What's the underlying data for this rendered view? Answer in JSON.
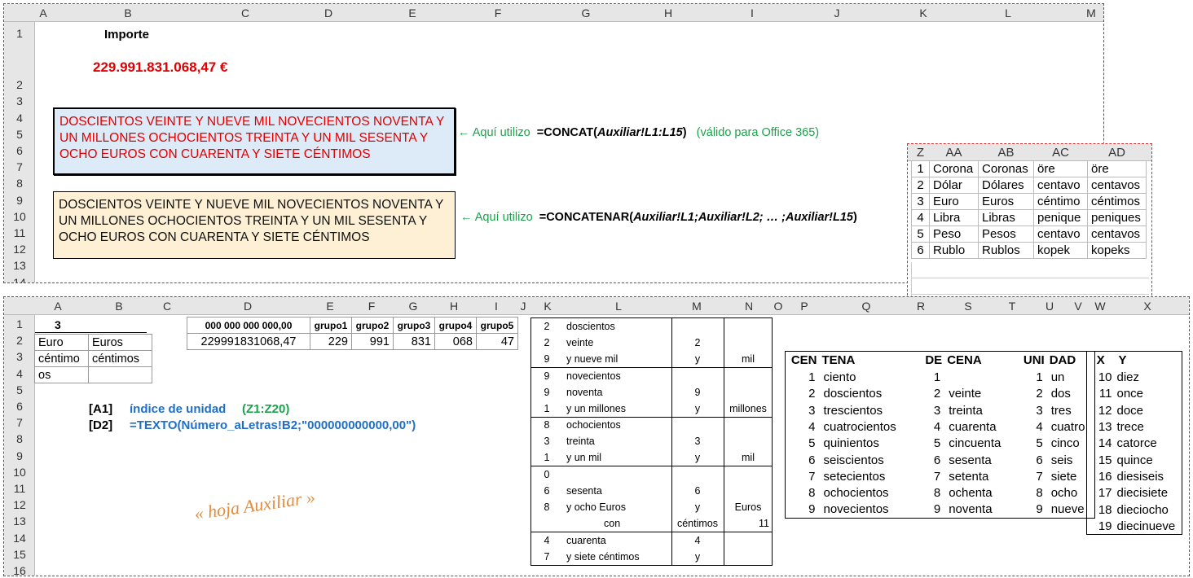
{
  "top": {
    "cols": [
      "A",
      "B",
      "C",
      "D",
      "E",
      "F",
      "G",
      "H",
      "I",
      "J",
      "K",
      "L",
      "M"
    ],
    "rows": [
      "1",
      "2",
      "3",
      "4",
      "5",
      "6",
      "7",
      "8",
      "9",
      "10",
      "11",
      "12",
      "13",
      "14"
    ],
    "importe_label": "Importe",
    "importe_value": "229.991.831.068,47 €",
    "box1_text": "DOSCIENTOS VEINTE Y NUEVE MIL NOVECIENTOS NOVENTA Y UN MILLONES OCHOCIENTOS TREINTA Y UN MIL SESENTA Y OCHO EUROS CON CUARENTA Y SIETE CÉNTIMOS",
    "box2_text": "DOSCIENTOS VEINTE Y NUEVE MIL NOVECIENTOS NOVENTA Y UN MILLONES OCHOCIENTOS TREINTA Y UN MIL SESENTA Y OCHO EUROS CON CUARENTA Y SIETE CÉNTIMOS",
    "note1_prefix": "← Aquí utilizo",
    "note1_formula_a": "=CONCAT(",
    "note1_formula_b": "Auxiliar!L1:L15",
    "note1_formula_c": ")",
    "note1_suffix": "(válido para Office 365)",
    "note2_prefix": "← Aquí utilizo",
    "note2_formula_a": "=CONCATENAR(",
    "note2_formula_b": "Auxiliar!L1;Auxiliar!L2; … ;Auxiliar!L15",
    "note2_formula_c": ")"
  },
  "currency": {
    "cols": [
      "Z",
      "AA",
      "AB",
      "AC",
      "AD"
    ],
    "rows": [
      [
        "1",
        "Corona",
        "Coronas",
        "öre",
        "öre"
      ],
      [
        "2",
        "Dólar",
        "Dólares",
        "centavo",
        "centavos"
      ],
      [
        "3",
        "Euro",
        "Euros",
        "céntimo",
        "céntimos"
      ],
      [
        "4",
        "Libra",
        "Libras",
        "penique",
        "peniques"
      ],
      [
        "5",
        "Peso",
        "Pesos",
        "centavo",
        "centavos"
      ],
      [
        "6",
        "Rublo",
        "Rublos",
        "kopek",
        "kopeks"
      ]
    ]
  },
  "aux": {
    "cols": [
      "A",
      "B",
      "C",
      "D",
      "E",
      "F",
      "G",
      "H",
      "I",
      "J",
      "K",
      "L",
      "M",
      "N",
      "O",
      "P",
      "Q",
      "R",
      "S",
      "T",
      "U",
      "V",
      "W",
      "X"
    ],
    "rows": [
      "1",
      "2",
      "3",
      "4",
      "5",
      "6",
      "7",
      "8",
      "9",
      "10",
      "11",
      "12",
      "13",
      "14",
      "15",
      "16"
    ],
    "a1": "3",
    "ab": [
      [
        "Euro",
        "Euros"
      ],
      [
        "céntimo",
        "céntimos"
      ],
      [
        "os",
        ""
      ]
    ],
    "d1": "000 000 000 000,00",
    "groups": [
      "grupo1",
      "grupo2",
      "grupo3",
      "grupo4",
      "grupo5"
    ],
    "d2": "229991831068,47",
    "group_vals": [
      "229",
      "991",
      "831",
      "068",
      "47"
    ],
    "ref_a1": "[A1]",
    "ref_a1_desc": "índice de unidad",
    "ref_a1_range": "(Z1:Z20)",
    "ref_d2": "[D2]",
    "ref_d2_formula": "=TEXTO(Número_aLetras!B2;\"000000000000,00\")",
    "sheet_label": "« hoja Auxiliar »",
    "mid_rows": [
      [
        "2",
        "doscientos",
        "",
        ""
      ],
      [
        "2",
        "veinte",
        "2",
        ""
      ],
      [
        "9",
        "y nueve mil",
        "y",
        "mil"
      ],
      [
        "9",
        "novecientos",
        "",
        ""
      ],
      [
        "9",
        "noventa",
        "9",
        ""
      ],
      [
        "1",
        "y un millones",
        "y",
        "millones"
      ],
      [
        "8",
        "ochocientos",
        "",
        ""
      ],
      [
        "3",
        "treinta",
        "3",
        ""
      ],
      [
        "1",
        "y un mil",
        "y",
        "mil"
      ],
      [
        "0",
        "",
        "",
        ""
      ],
      [
        "6",
        "sesenta",
        "6",
        ""
      ],
      [
        "8",
        "y ocho Euros",
        "y",
        "Euros"
      ],
      [
        "",
        "con",
        "céntimos",
        "11"
      ],
      [
        "4",
        "cuarenta",
        "4",
        ""
      ],
      [
        "7",
        "y siete céntimos",
        "y",
        ""
      ]
    ],
    "words_header": [
      "CEN",
      "TENA",
      "DE",
      "CENA",
      "UNI",
      "DAD"
    ],
    "words": [
      [
        "1",
        "ciento",
        "1",
        "",
        "1",
        "un"
      ],
      [
        "2",
        "doscientos",
        "2",
        "veinte",
        "2",
        "dos"
      ],
      [
        "3",
        "trescientos",
        "3",
        "treinta",
        "3",
        "tres"
      ],
      [
        "4",
        "cuatrocientos",
        "4",
        "cuarenta",
        "4",
        "cuatro"
      ],
      [
        "5",
        "quinientos",
        "5",
        "cincuenta",
        "5",
        "cinco"
      ],
      [
        "6",
        "seiscientos",
        "6",
        "sesenta",
        "6",
        "seis"
      ],
      [
        "7",
        "setecientos",
        "7",
        "setenta",
        "7",
        "siete"
      ],
      [
        "8",
        "ochocientos",
        "8",
        "ochenta",
        "8",
        "ocho"
      ],
      [
        "9",
        "novecientos",
        "9",
        "noventa",
        "9",
        "nueve"
      ]
    ],
    "xy_header": [
      "X",
      "Y"
    ],
    "xy": [
      [
        "10",
        "diez"
      ],
      [
        "11",
        "once"
      ],
      [
        "12",
        "doce"
      ],
      [
        "13",
        "trece"
      ],
      [
        "14",
        "catorce"
      ],
      [
        "15",
        "quince"
      ],
      [
        "16",
        "diesiseis"
      ],
      [
        "17",
        "diecisiete"
      ],
      [
        "18",
        "dieciocho"
      ],
      [
        "19",
        "diecinueve"
      ]
    ]
  }
}
